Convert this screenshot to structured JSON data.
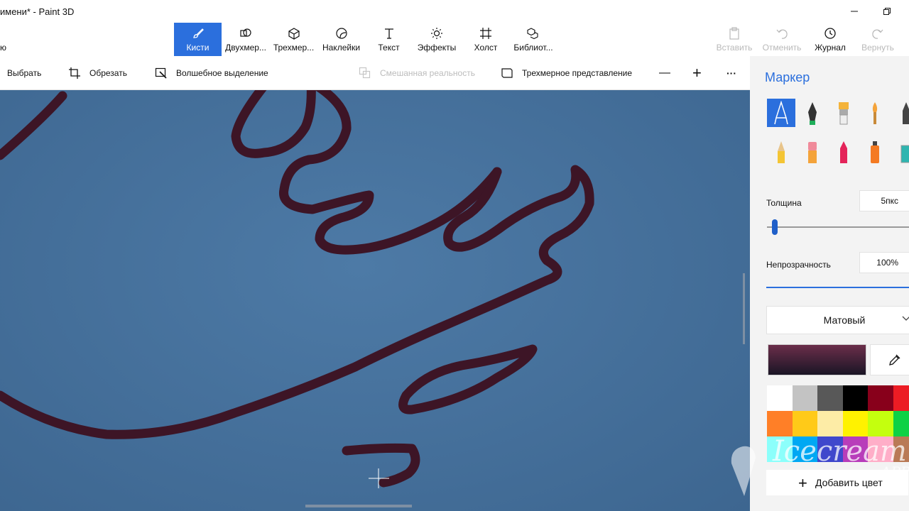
{
  "window": {
    "title": "имени* - Paint 3D"
  },
  "toolbar": {
    "items": [
      {
        "label": "Кисти",
        "icon": "brush-icon"
      },
      {
        "label": "Двухмер...",
        "icon": "2d-shapes-icon"
      },
      {
        "label": "Трехмер...",
        "icon": "3d-shapes-icon"
      },
      {
        "label": "Наклейки",
        "icon": "stickers-icon"
      },
      {
        "label": "Текст",
        "icon": "text-icon"
      },
      {
        "label": "Эффекты",
        "icon": "effects-icon"
      },
      {
        "label": "Холст",
        "icon": "canvas-icon"
      },
      {
        "label": "Библиот...",
        "icon": "library-icon"
      }
    ],
    "left_cut_label": "ю",
    "paste_label": "Вставить",
    "undo_label": "Отменить",
    "history_label": "Журнал",
    "redo_label": "Вернуть"
  },
  "commandbar": {
    "select_label": "Выбрать",
    "crop_label": "Обрезать",
    "magic_select_label": "Волшебное выделение",
    "mixed_reality_label": "Смешанная реальность",
    "view3d_label": "Трехмерное представление",
    "zoom_out_symbol": "—",
    "zoom_in_symbol": "+",
    "more_symbol": "···"
  },
  "panel": {
    "title": "Маркер",
    "thickness_label": "Толщина",
    "thickness_value": "5пкс",
    "opacity_label": "Непрозрачность",
    "opacity_value": "100%",
    "finish_value": "Матовый",
    "add_color_label": "Добавить цвет",
    "current_color_top": "#6b2e4a",
    "current_color_bottom": "#1a1525",
    "palette": [
      "#ffffff",
      "#c3c3c3",
      "#585858",
      "#000000",
      "#88001b",
      "#ec1c24",
      "#ff7f27",
      "#ffca18",
      "#fdeca6",
      "#fff200",
      "#c4ff0e",
      "#0ed145",
      "#8cfffb",
      "#00a8f3",
      "#3f48cc",
      "#b83dba",
      "#ffaec8",
      "#b97a56"
    ]
  },
  "watermark": {
    "line1": "Icecream",
    "line2": "APPS"
  }
}
